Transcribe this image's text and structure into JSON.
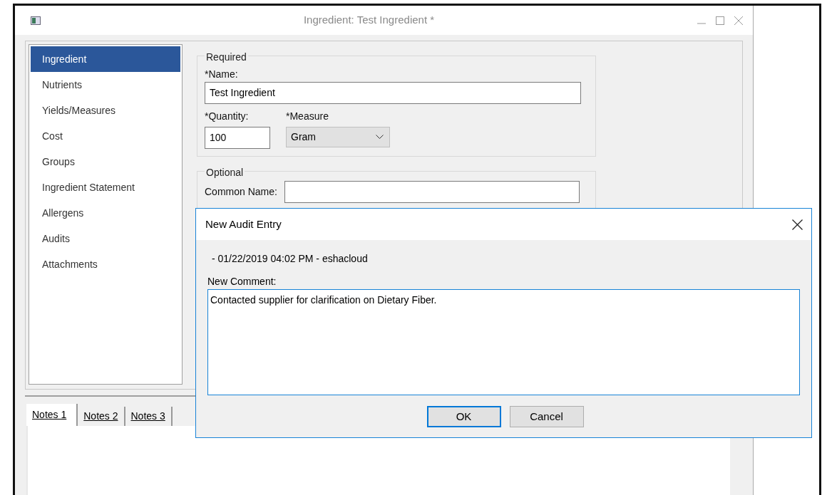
{
  "window": {
    "title": "Ingredient: Test Ingredient *"
  },
  "sidebar": {
    "items": [
      {
        "label": "Ingredient",
        "selected": true
      },
      {
        "label": "Nutrients",
        "selected": false
      },
      {
        "label": "Yields/Measures",
        "selected": false
      },
      {
        "label": "Cost",
        "selected": false
      },
      {
        "label": "Groups",
        "selected": false
      },
      {
        "label": "Ingredient Statement",
        "selected": false
      },
      {
        "label": "Allergens",
        "selected": false
      },
      {
        "label": "Audits",
        "selected": false
      },
      {
        "label": "Attachments",
        "selected": false
      }
    ]
  },
  "required": {
    "legend": "Required",
    "name_label": "*Name:",
    "name_value": "Test Ingredient",
    "quantity_label": "*Quantity:",
    "quantity_value": "100",
    "measure_label": "*Measure",
    "measure_value": "Gram"
  },
  "optional": {
    "legend": "Optional",
    "common_name_label": "Common Name:"
  },
  "notes_tabs": [
    {
      "label": "Notes 1",
      "selected": true
    },
    {
      "label": "Notes 2",
      "selected": false
    },
    {
      "label": "Notes 3",
      "selected": false
    }
  ],
  "dialog": {
    "title": "New Audit Entry",
    "entry_line": "- 01/22/2019 04:02 PM - eshacloud",
    "comment_label": "New Comment:",
    "comment_value": "Contacted supplier for clarification on Dietary Fiber.",
    "buttons": [
      {
        "label": "OK",
        "default": true
      },
      {
        "label": "Cancel",
        "default": false
      }
    ]
  }
}
